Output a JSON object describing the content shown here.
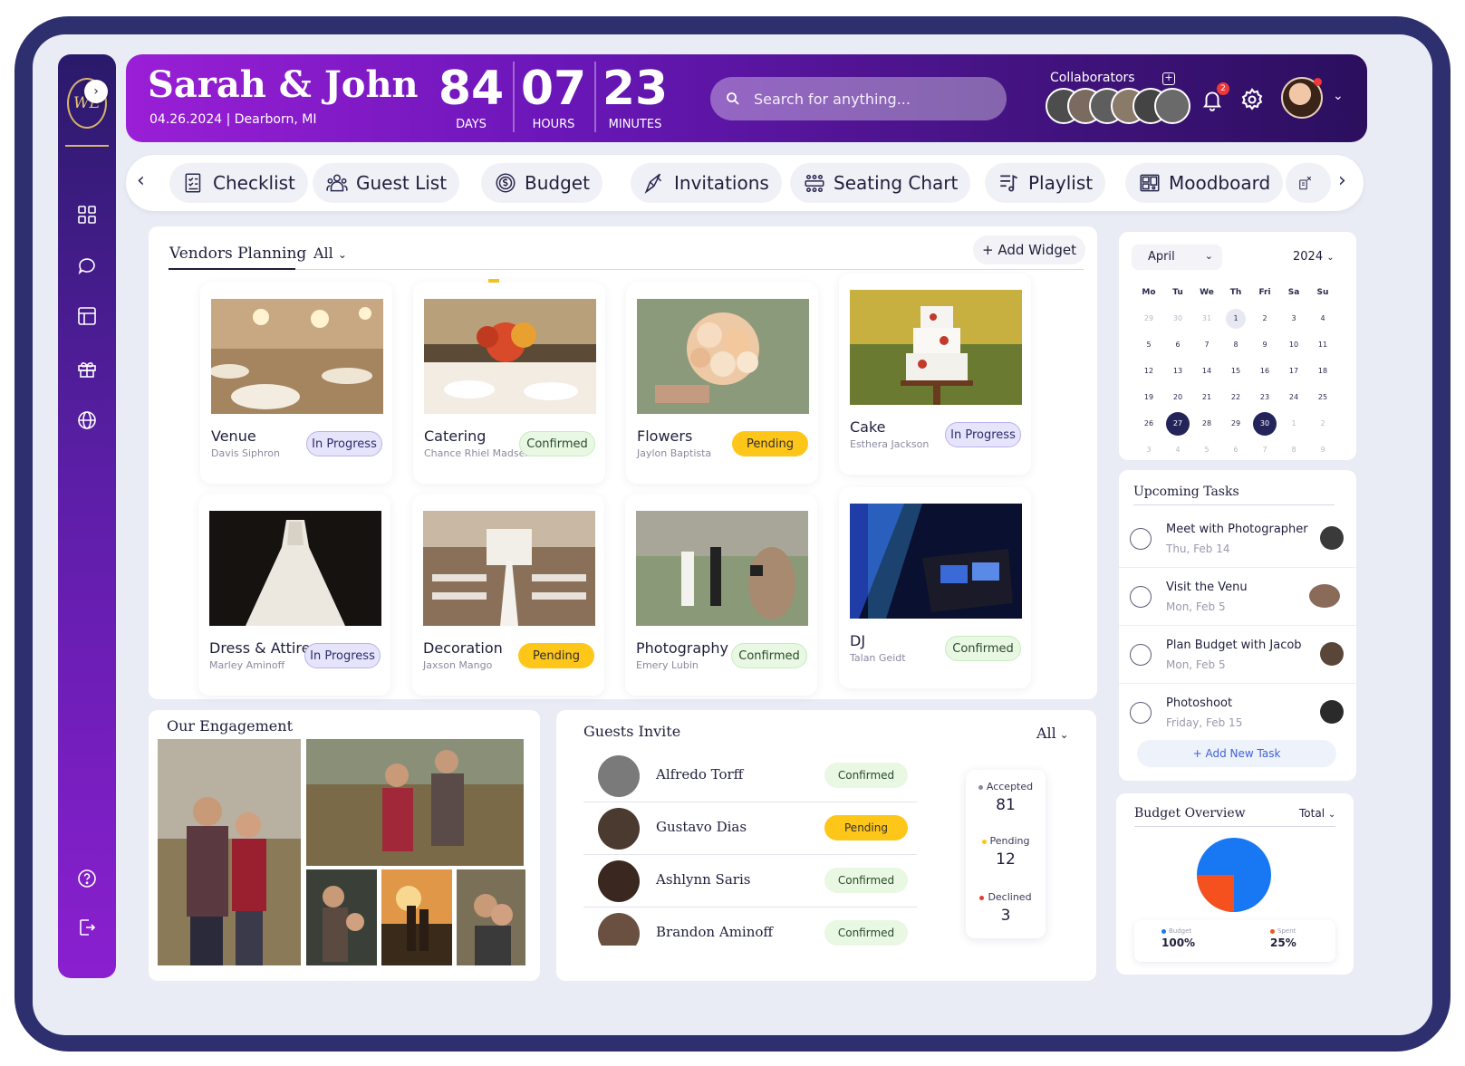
{
  "header": {
    "couple": "Sarah & John",
    "date_location": "04.26.2024 | Dearborn, MI",
    "countdown": [
      {
        "value": "84",
        "label": "DAYS"
      },
      {
        "value": "07",
        "label": "HOURS"
      },
      {
        "value": "23",
        "label": "MINUTES"
      }
    ],
    "search_placeholder": "Search for anything...",
    "collaborators_label": "Collaborators",
    "notification_count": "2",
    "logo_initials": "WE"
  },
  "nav": {
    "tabs": [
      "Checklist",
      "Guest List",
      "Budget",
      "Invitations",
      "Seating Chart",
      "Playlist",
      "Moodboard"
    ]
  },
  "vendors": {
    "title": "Vendors Planning",
    "filter": "All",
    "add_widget": "+ Add Widget",
    "cards": [
      {
        "name": "Venue",
        "person": "Davis Siphron",
        "status": "In Progress"
      },
      {
        "name": "Catering",
        "person": "Chance Rhiel Madsen",
        "status": "Confirmed"
      },
      {
        "name": "Flowers",
        "person": "Jaylon Baptista",
        "status": "Pending"
      },
      {
        "name": "Cake",
        "person": "Esthera Jackson",
        "status": "In Progress"
      },
      {
        "name": "Dress & Attire",
        "person": "Marley Aminoff",
        "status": "In Progress"
      },
      {
        "name": "Decoration",
        "person": "Jaxson Mango",
        "status": "Pending"
      },
      {
        "name": "Photography",
        "person": "Emery Lubin",
        "status": "Confirmed"
      },
      {
        "name": "DJ",
        "person": "Talan Geidt",
        "status": "Confirmed"
      }
    ]
  },
  "calendar": {
    "month": "April",
    "year": "2024",
    "weekdays": [
      "Mo",
      "Tu",
      "We",
      "Th",
      "Fri",
      "Sa",
      "Su"
    ],
    "weeks": [
      [
        "29",
        "30",
        "31",
        "1",
        "2",
        "3",
        "4"
      ],
      [
        "5",
        "6",
        "7",
        "8",
        "9",
        "10",
        "11"
      ],
      [
        "12",
        "13",
        "14",
        "15",
        "16",
        "17",
        "18"
      ],
      [
        "19",
        "20",
        "21",
        "22",
        "23",
        "24",
        "25"
      ],
      [
        "26",
        "27",
        "28",
        "29",
        "30",
        "1",
        "2"
      ],
      [
        "3",
        "4",
        "5",
        "6",
        "7",
        "8",
        "9"
      ]
    ]
  },
  "tasks": {
    "title": "Upcoming Tasks",
    "items": [
      {
        "name": "Meet with Photographer",
        "date": "Thu, Feb 14"
      },
      {
        "name": "Visit the Venu",
        "date": "Mon, Feb 5"
      },
      {
        "name": "Plan Budget with Jacob",
        "date": "Mon, Feb 5"
      },
      {
        "name": "Photoshoot",
        "date": "Friday, Feb 15"
      }
    ],
    "add_label": "+ Add New Task"
  },
  "engagement": {
    "title": "Our Engagement"
  },
  "guests": {
    "title": "Guests Invite",
    "filter": "All",
    "rows": [
      {
        "name": "Alfredo Torff",
        "status": "Confirmed"
      },
      {
        "name": "Gustavo Dias",
        "status": "Pending"
      },
      {
        "name": "Ashlynn Saris",
        "status": "Confirmed"
      },
      {
        "name": "Brandon Aminoff",
        "status": "Confirmed"
      }
    ],
    "stats": [
      {
        "label": "Accepted",
        "value": "81",
        "color": "#8a8aa0"
      },
      {
        "label": "Pending",
        "value": "12",
        "color": "#ffc61a"
      },
      {
        "label": "Declined",
        "value": "3",
        "color": "#e53935"
      }
    ]
  },
  "budget": {
    "title": "Budget Overview",
    "filter": "Total",
    "legend": [
      {
        "label": "Budget",
        "value": "100%",
        "color": "#1877f2"
      },
      {
        "label": "Spent",
        "value": "25%",
        "color": "#f4511e"
      }
    ],
    "spent_fraction": 0.25
  },
  "colors": {
    "accent": "#8a1fd0",
    "navy": "#24245a",
    "pending": "#ffc61a",
    "confirmed_bg": "#e8f8e2",
    "progress_bg": "#e6e4fa"
  }
}
